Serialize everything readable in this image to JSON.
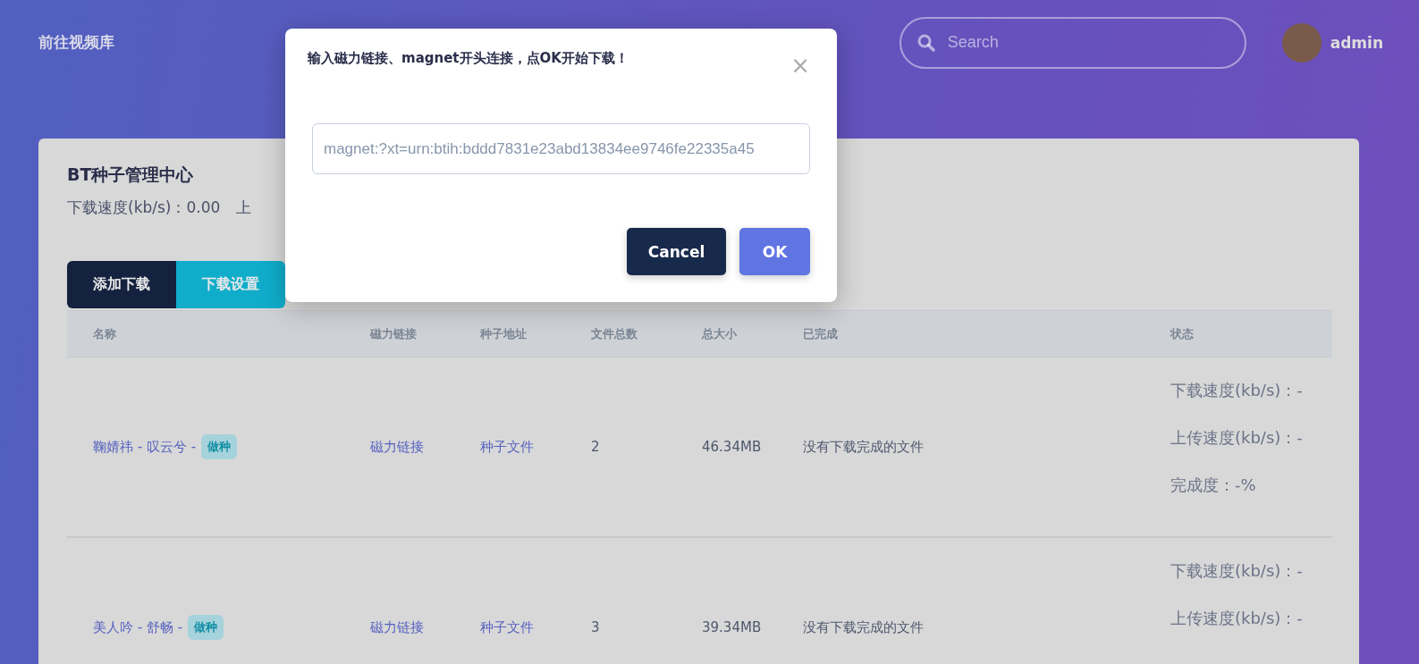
{
  "header": {
    "title": "前往视频库",
    "search": {
      "placeholder": "Search"
    },
    "user": {
      "name": "admin"
    }
  },
  "card": {
    "title": "BT种子管理中心",
    "stats": "下载速度(kb/s)：0.00",
    "stats_cut": "上",
    "buttons": [
      {
        "label": "添加下载",
        "kind": "dark"
      },
      {
        "label": "下载设置",
        "kind": "cyan"
      }
    ]
  },
  "table": {
    "columns": [
      "名称",
      "磁力链接",
      "种子地址",
      "文件总数",
      "总大小",
      "已完成",
      "状态"
    ],
    "rows": [
      {
        "name": "鞠婧祎 - 叹云兮 -",
        "tag": "做种",
        "magnet": "磁力链接",
        "torrent": "种子文件",
        "files": "2",
        "size": "46.34MB",
        "done": "没有下载完成的文件",
        "status": [
          "下载速度(kb/s)：-",
          "上传速度(kb/s)：-",
          "完成度：-%"
        ]
      },
      {
        "name": "美人吟 - 舒畅 -",
        "tag": "做种",
        "magnet": "磁力链接",
        "torrent": "种子文件",
        "files": "3",
        "size": "39.34MB",
        "done": "没有下载完成的文件",
        "status": [
          "下载速度(kb/s)：-",
          "上传速度(kb/s)：-"
        ]
      }
    ]
  },
  "dialog": {
    "title": "输入磁力链接、magnet开头连接，点OK开始下载！",
    "close": "×",
    "input": {
      "placeholder": "magnet:?xt=urn:btih:bddd7831e23abd13834ee9746fe22335a45"
    },
    "buttons": [
      {
        "label": "Cancel",
        "kind": "dark"
      },
      {
        "label": "OK",
        "kind": "primary"
      }
    ]
  }
}
